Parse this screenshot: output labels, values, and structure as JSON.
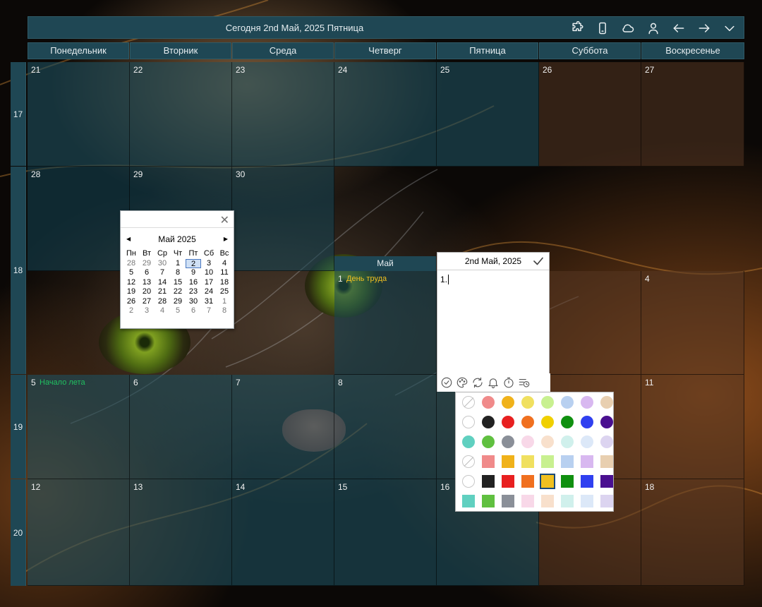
{
  "topbar": {
    "title": "Сегодня 2nd Май, 2025 Пятница",
    "icons": [
      "puzzle-icon",
      "phone-icon",
      "cloud-icon",
      "user-icon",
      "arrow-left-icon",
      "arrow-right-icon",
      "chevron-down-icon"
    ]
  },
  "weekdays": [
    "Понедельник",
    "Вторник",
    "Среда",
    "Четверг",
    "Пятница",
    "Суббота",
    "Воскресенье"
  ],
  "weeks": [
    "17",
    "18",
    "19",
    "20"
  ],
  "days": {
    "w17": [
      "21",
      "22",
      "23",
      "24",
      "25",
      "26",
      "27"
    ],
    "w18": [
      "28",
      "29",
      "30",
      "1",
      "4"
    ],
    "w19": [
      "5",
      "6",
      "7",
      "8",
      "11"
    ],
    "w20": [
      "12",
      "13",
      "14",
      "15",
      "16",
      "18"
    ]
  },
  "events": {
    "may1": {
      "text": "День труда",
      "color": "#f0c020"
    },
    "june5": {
      "text": "Начало лета",
      "color": "#20c060"
    }
  },
  "month_tab": "Май",
  "mini_calendar": {
    "title": "Май 2025",
    "close": "✕",
    "dow": [
      "Пн",
      "Вт",
      "Ср",
      "Чт",
      "Пт",
      "Сб",
      "Вс"
    ],
    "rows": [
      [
        "28",
        "29",
        "30",
        "1",
        "2",
        "3",
        "4"
      ],
      [
        "5",
        "6",
        "7",
        "8",
        "9",
        "10",
        "11"
      ],
      [
        "12",
        "13",
        "14",
        "15",
        "16",
        "17",
        "18"
      ],
      [
        "19",
        "20",
        "21",
        "22",
        "23",
        "24",
        "25"
      ],
      [
        "26",
        "27",
        "28",
        "29",
        "30",
        "31",
        "1"
      ],
      [
        "2",
        "3",
        "4",
        "5",
        "6",
        "7",
        "8"
      ]
    ],
    "today": "2"
  },
  "editor": {
    "date": "2nd Май, 2025",
    "content": "1.",
    "tools": [
      "check-circle-icon",
      "palette-icon",
      "repeat-icon",
      "bell-icon",
      "timer-icon",
      "list-clock-icon"
    ]
  },
  "palette": {
    "rows": [
      [
        "#f08a8a",
        "#f0b21a",
        "#f0e060",
        "#c8f090",
        "#b8d0f0",
        "#d8b8f0",
        "#e8cfb0"
      ],
      [
        "#222222",
        "#e82020",
        "#f07020",
        "#f0d000",
        "#109010",
        "#3040f0",
        "#4a1090"
      ],
      [
        "#60d0c0",
        "#60c040",
        "#8a8f98",
        "#f8d8e8",
        "#f8e0cc",
        "#d0f0ec",
        "#dce8f8",
        "#dcd4f0"
      ],
      [
        "#f08a8a",
        "#f0b21a",
        "#f0e060",
        "#c8f090",
        "#b8d0f0",
        "#d8b8f0",
        "#e8cfb0"
      ],
      [
        "#222222",
        "#e82020",
        "#f07020",
        "#f0c020",
        "#109010",
        "#3040f0",
        "#4a1090"
      ],
      [
        "#60d0c0",
        "#60c040",
        "#8a8f98",
        "#f8d8e8",
        "#f8e0cc",
        "#d0f0ec",
        "#dce8f8",
        "#dcd4f0"
      ]
    ],
    "selected": "#f0c020"
  }
}
